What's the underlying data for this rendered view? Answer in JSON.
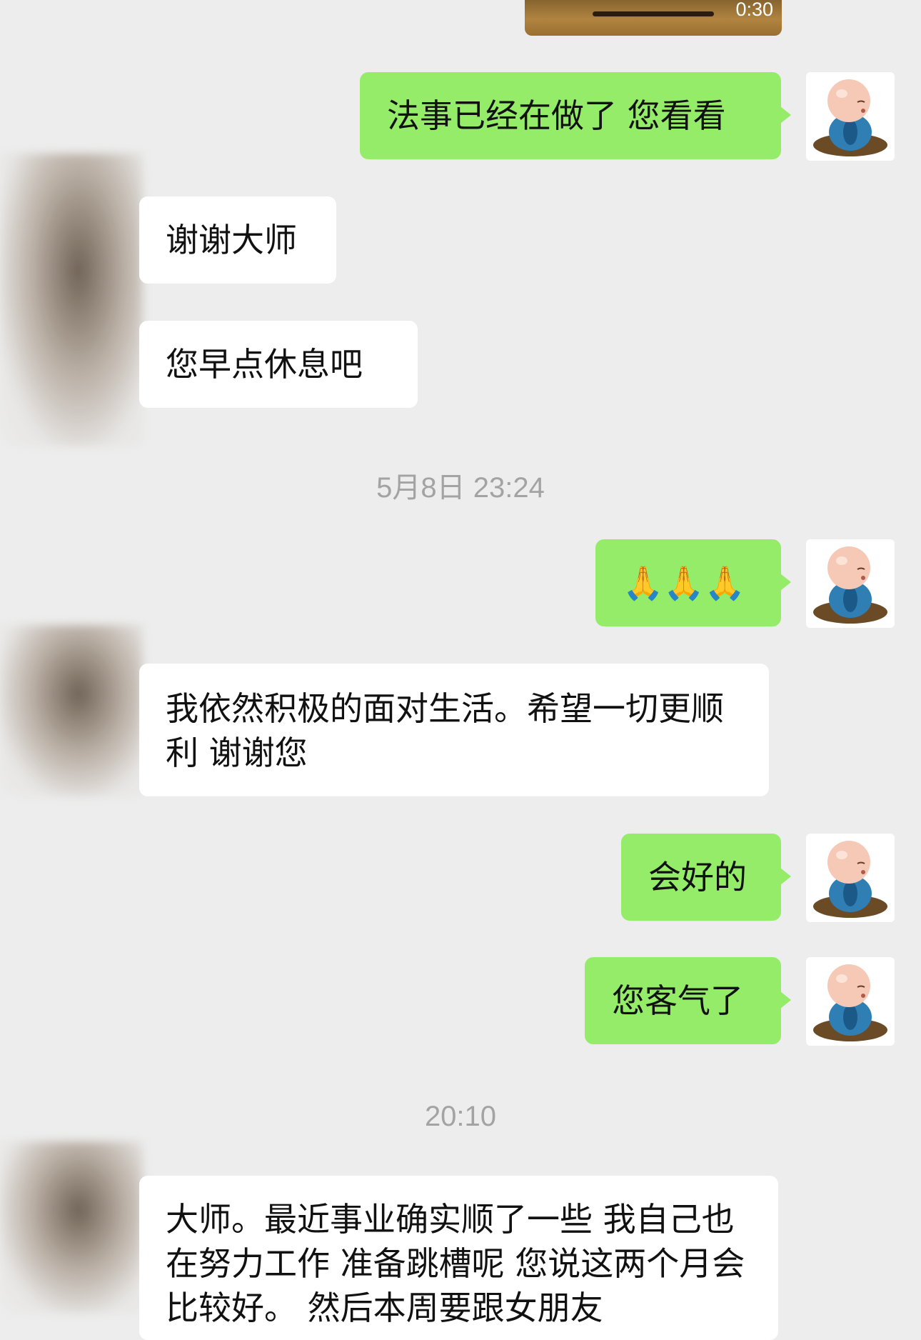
{
  "video": {
    "duration": "0:30"
  },
  "messages": [
    {
      "text": "法事已经在做了 您看看"
    },
    {
      "text": "谢谢大师"
    },
    {
      "text": "您早点休息吧"
    },
    {
      "text": "🙏🙏🙏"
    },
    {
      "text": "我依然积极的面对生活。希望一切更顺利 谢谢您"
    },
    {
      "text": "会好的"
    },
    {
      "text": "您客气了"
    },
    {
      "text": "大师。最近事业确实顺了一些 我自己也在努力工作 准备跳槽呢  您说这两个月会比较好。 然后本周要跟女朋友"
    }
  ],
  "timestamps": [
    "5月8日 23:24",
    "20:10"
  ],
  "avatars": {
    "me": "praying-monk-avatar",
    "them": "blurred-avatar"
  },
  "colors": {
    "background": "#ededed",
    "outgoing_bubble": "#95ec69",
    "incoming_bubble": "#ffffff",
    "timestamp": "#a3a3a3"
  }
}
